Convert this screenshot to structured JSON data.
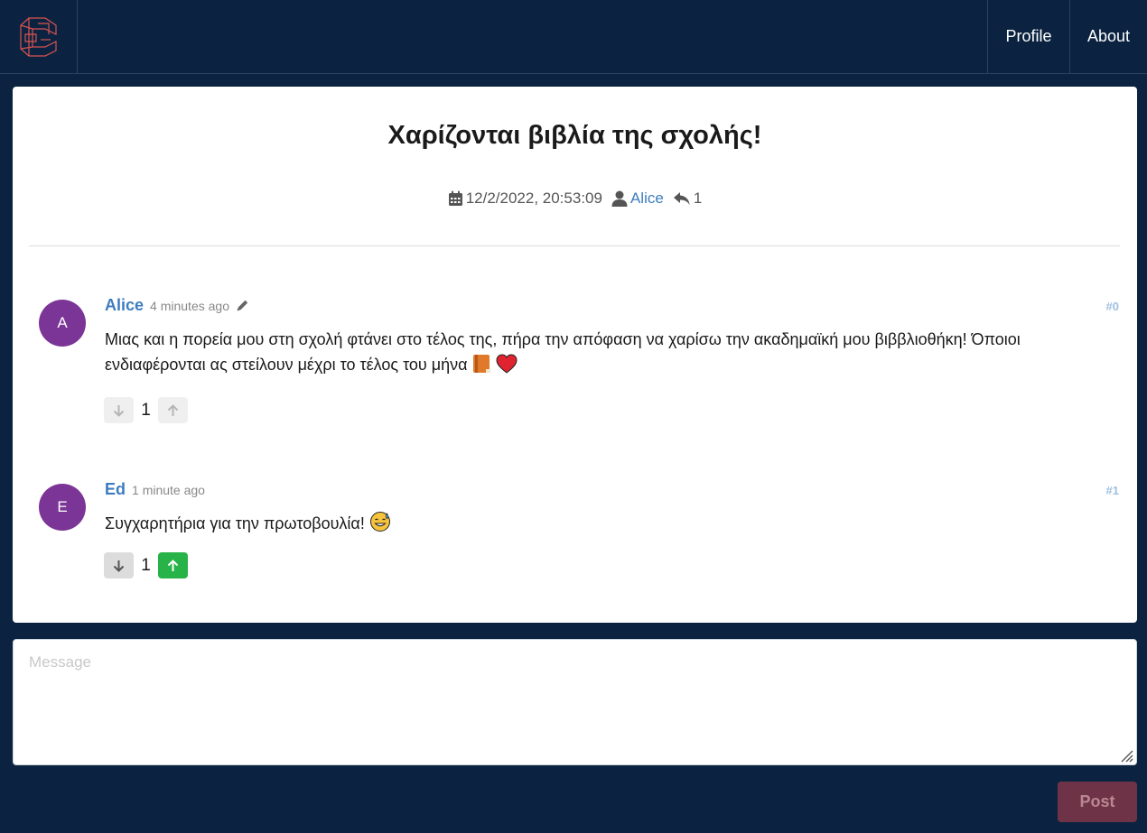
{
  "nav": {
    "logo_icon": "app-logo",
    "profile_label": "Profile",
    "about_label": "About"
  },
  "thread": {
    "title": "Χαρίζονται βιβλία της σχολής!",
    "date": "12/2/2022, 20:53:09",
    "author": "Alice",
    "reply_count": "1"
  },
  "comments": [
    {
      "avatar_letter": "A",
      "author": "Alice",
      "time": "4 minutes ago",
      "edited_icon": "pencil-icon",
      "number": "#0",
      "text": "Μιας και η πορεία μου στη σχολή φτάνει στο τέλος της, πήρα την απόφαση να χαρίσω την ακαδημαϊκή μου βιββλιοθήκη! Όποιοι ενδιαφέρονται ας στείλουν μέχρι το τέλος του μήνα",
      "emojis": [
        "book-emoji",
        "heart-emoji"
      ],
      "score": "1",
      "vote_state": "none"
    },
    {
      "avatar_letter": "E",
      "author": "Ed",
      "time": "1 minute ago",
      "number": "#1",
      "text": "Συγχαρητήρια για την πρωτοβουλία!",
      "emojis": [
        "sweat-smile-emoji"
      ],
      "score": "1",
      "vote_state": "up"
    }
  ],
  "composer": {
    "placeholder": "Message",
    "value": "",
    "post_label": "Post"
  },
  "colors": {
    "background": "#0b2341",
    "link": "#3d7cc0",
    "avatar": "#7b3596",
    "upvote_active": "#27b347",
    "post_button": "#6f3347"
  }
}
